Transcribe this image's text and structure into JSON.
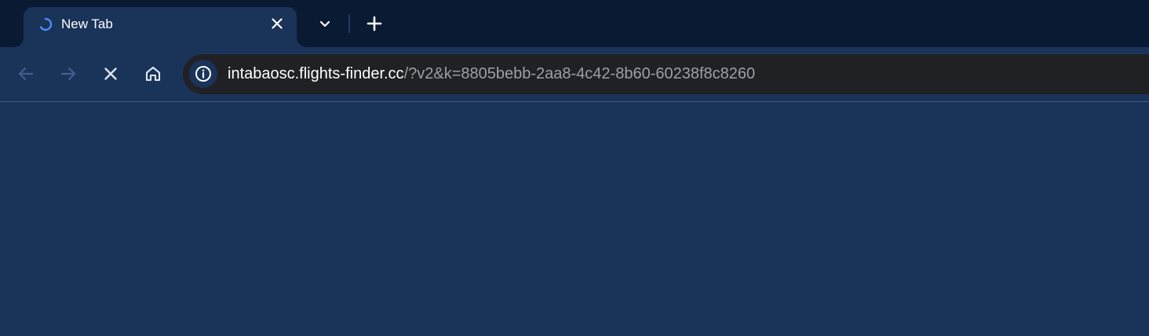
{
  "tab": {
    "title": "New Tab",
    "spinner_icon": "loading-spinner-icon",
    "close_icon": "close-icon"
  },
  "tabstrip": {
    "search_tabs_icon": "chevron-down-icon",
    "new_tab_icon": "plus-icon"
  },
  "toolbar": {
    "back_icon": "arrow-left-icon",
    "forward_icon": "arrow-right-icon",
    "stop_icon": "close-icon",
    "home_icon": "home-icon"
  },
  "omnibox": {
    "info_icon": "info-icon",
    "url_host": "intabaosc.flights-finder.cc",
    "url_path": "/?v2&k=8805bebb-2aa8-4c42-8b60-60238f8c8260"
  },
  "colors": {
    "frame": "#0b1a33",
    "toolbar": "#1a3359",
    "omnibox": "#202124",
    "spinner": "#4c8df6",
    "text": "#ffffff",
    "muted_text": "#9aa0a6"
  }
}
